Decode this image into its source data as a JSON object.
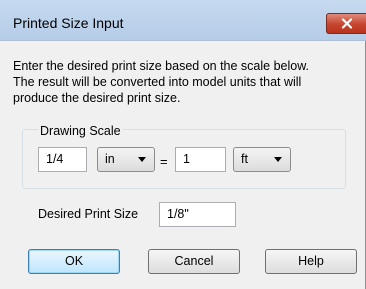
{
  "dialog": {
    "title": "Printed Size Input",
    "description_lines": [
      "Enter the desired print size based on the scale below.",
      "The result will be converted into model units that will",
      "produce the desired print size."
    ]
  },
  "drawing_scale": {
    "group_label": "Drawing Scale",
    "paper_value": "1/4",
    "paper_unit": "in",
    "equals": "=",
    "model_value": "1",
    "model_unit": "ft"
  },
  "print_size": {
    "label": "Desired Print Size",
    "value": "1/8\""
  },
  "buttons": {
    "ok": "OK",
    "cancel": "Cancel",
    "help": "Help"
  },
  "icons": {
    "close": "close-icon",
    "dropdown": "chevron-down-icon"
  },
  "colors": {
    "close_button": "#c5452f",
    "titlebar": "#c5d9ef",
    "default_button_border": "#3c7fb1"
  }
}
